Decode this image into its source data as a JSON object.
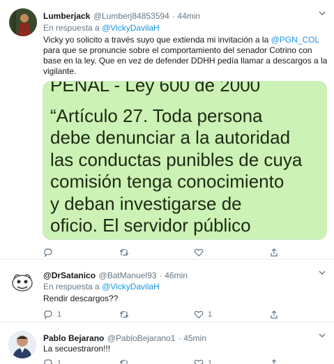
{
  "tweets": [
    {
      "name": "Lumberjack",
      "handle": "@Lumberj84853594",
      "time": "· 44min",
      "reply_prefix": "En respuesta a",
      "reply_mention": "@VickyDavilaH",
      "text_before": "Vicky yo solicito a través suyo que extienda mi invitación a la ",
      "text_mention": "@PGN_COL",
      "text_after": " para que se pronuncie sobre el comportamiento del senador Cotrino con base en la ley. Que en vez de defender DDHH pedía llamar a descargos a la vigilante.",
      "media": {
        "top_cut": "PENAL - Ley 600 de 2000",
        "lines": [
          "“Artículo 27.  Toda persona",
          "debe denunciar a la autoridad",
          "las conductas punibles de cuya",
          "comisión tenga conocimiento",
          "y deban investigarse de",
          "oficio. El servidor público"
        ]
      },
      "actions": {
        "reply_count": "",
        "retweet_count": "",
        "like_count": ""
      }
    },
    {
      "name": "@DrSatanico",
      "handle": "@BatManuel93",
      "time": "· 46min",
      "reply_prefix": "En respuesta a",
      "reply_mention": "@VickyDavilaH",
      "text": "Rendir descargos??",
      "actions": {
        "reply_count": "1",
        "retweet_count": "",
        "like_count": "1"
      }
    },
    {
      "name": "Pablo Bejarano",
      "handle": "@PabloBejarano1",
      "time": "· 45min",
      "text": "La secuestraron!!!",
      "actions": {
        "reply_count": "1",
        "retweet_count": "",
        "like_count": "1"
      }
    }
  ],
  "icons": {
    "more": "chevron-down-icon",
    "reply": "reply-icon",
    "retweet": "retweet-icon",
    "like": "heart-icon",
    "share": "share-icon"
  },
  "colors": {
    "link": "#1b95e0",
    "muted": "#657786",
    "media_bg": "#ccf2b5"
  }
}
